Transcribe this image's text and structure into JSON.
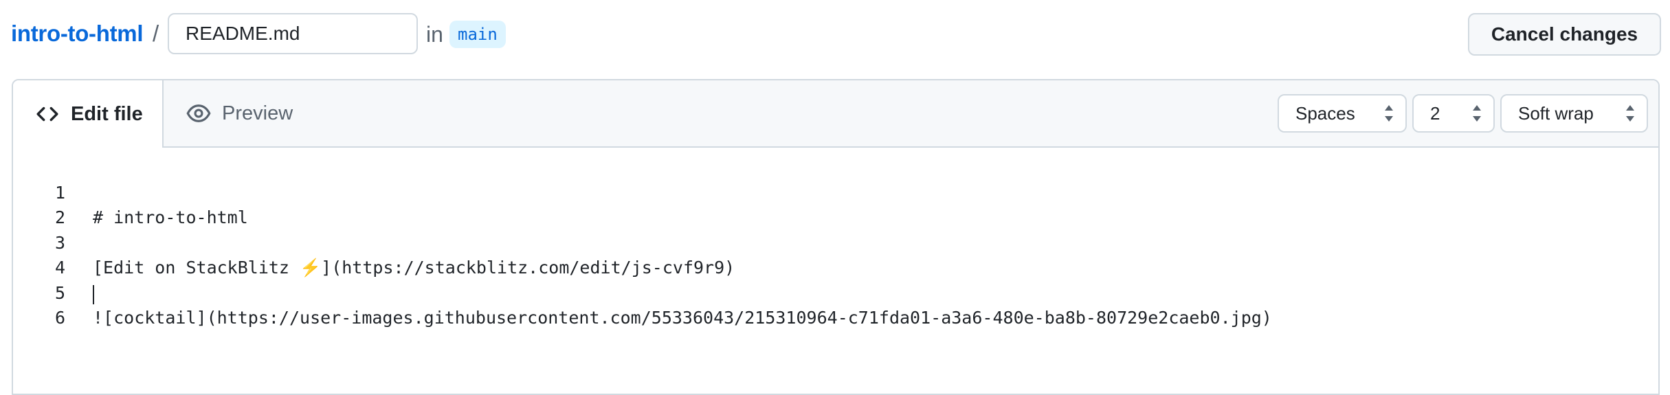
{
  "header": {
    "repo_name": "intro-to-html",
    "separator": "/",
    "filename_value": "README.md",
    "in_label": "in",
    "branch": "main",
    "cancel_label": "Cancel changes"
  },
  "tabs": {
    "edit_label": "Edit file",
    "preview_label": "Preview",
    "edit_icon": "code-icon",
    "preview_icon": "eye-icon"
  },
  "toolbar": {
    "indent_mode": "Spaces",
    "indent_size": "2",
    "wrap_mode": "Soft wrap"
  },
  "editor": {
    "lines": [
      {
        "number": "1",
        "text": "# intro-to-html"
      },
      {
        "number": "2",
        "text": ""
      },
      {
        "number": "3",
        "text": "[Edit on StackBlitz ⚡️](https://stackblitz.com/edit/js-cvf9r9)"
      },
      {
        "number": "4",
        "text": ""
      },
      {
        "number": "5",
        "text": "![cocktail](https://user-images.githubusercontent.com/55336043/215310964-c71fda01-a3a6-480e-ba8b-80729e2caeb0.jpg)"
      },
      {
        "number": "6",
        "text": ""
      }
    ]
  },
  "colors": {
    "link": "#0969da",
    "branch_bg": "#ddf4ff",
    "border": "#d1d9e0",
    "header_bg": "#f6f8fa"
  }
}
